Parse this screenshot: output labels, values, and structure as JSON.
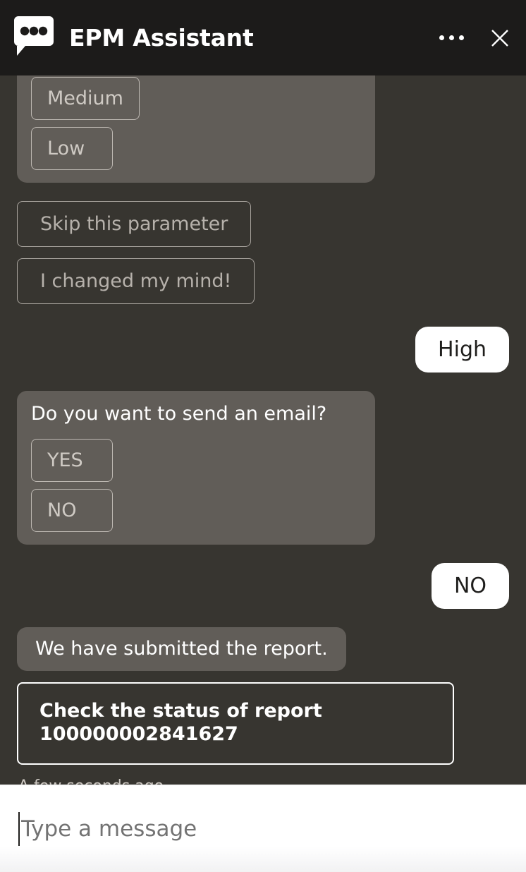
{
  "header": {
    "title": "EPM Assistant",
    "logo_icon": "chat-bubble-icon",
    "menu_icon": "more-options-icon",
    "close_icon": "close-icon"
  },
  "chat": {
    "messages": [
      {
        "sender": "bot",
        "type": "choices",
        "text": "",
        "choices": [
          "Medium",
          "Low"
        ]
      },
      {
        "sender": "bot",
        "type": "quick_reply",
        "label": "Skip this parameter"
      },
      {
        "sender": "bot",
        "type": "quick_reply",
        "label": "I changed my mind!"
      },
      {
        "sender": "user",
        "type": "text",
        "text": "High"
      },
      {
        "sender": "bot",
        "type": "choices",
        "text": "Do you want to send an email?",
        "choices": [
          "YES",
          "NO"
        ]
      },
      {
        "sender": "user",
        "type": "text",
        "text": "NO"
      },
      {
        "sender": "bot",
        "type": "text",
        "text": "We have submitted the report."
      },
      {
        "sender": "bot",
        "type": "action_card",
        "line1": "Check the status of report",
        "line2": "100000002841627"
      }
    ],
    "timestamp": "A few seconds ago"
  },
  "composer": {
    "placeholder": "Type a message",
    "value": ""
  },
  "colors": {
    "header_bg": "#1c1b1a",
    "chat_bg": "#373530",
    "bot_bubble_bg": "#615d58",
    "user_bubble_bg": "#ffffff",
    "button_border": "#a9a49e",
    "accent_text": "#ffffff",
    "composer_bg": "#ffffff"
  }
}
